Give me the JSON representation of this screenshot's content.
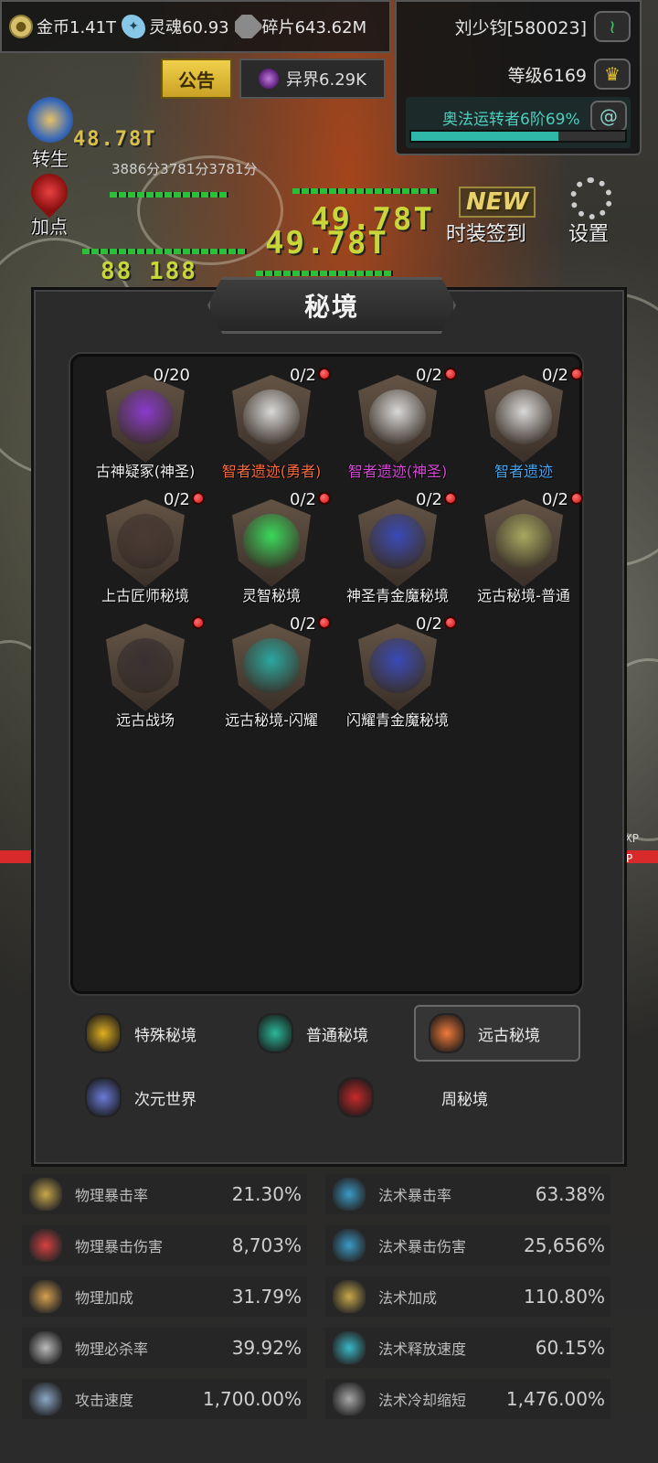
{
  "resources": {
    "gold": "金币1.41T",
    "soul": "灵魂60.93",
    "shard": "碎片643.62M"
  },
  "player": {
    "name": "刘少钧[580023]",
    "level": "等级6169",
    "arcane_title": "奥法运转者6阶69%",
    "arcane_progress": 0.69
  },
  "top_buttons": {
    "notice": "公告",
    "otherworld": "异界6.29K"
  },
  "side": {
    "rebirth": "转生",
    "addpoint": "加点",
    "score_text": "3886分3781分3781分"
  },
  "top_right": {
    "new_tag": "NEW",
    "costume_signin": "时装签到",
    "settings": "设置"
  },
  "modal": {
    "title": "秘境",
    "dungeons": [
      {
        "label": "古神疑冢(神圣)",
        "counter": "0/20",
        "red_dot": false,
        "label_color": "#f2f2f2",
        "art": "#8a3acb"
      },
      {
        "label": "智者遗迹(勇者)",
        "counter": "0/2",
        "red_dot": true,
        "label_color": "#ff6a3c",
        "art": "#d8d8d8"
      },
      {
        "label": "智者遗迹(神圣)",
        "counter": "0/2",
        "red_dot": true,
        "label_color": "#d84ad8",
        "art": "#d8d8d8"
      },
      {
        "label": "智者遗迹",
        "counter": "0/2",
        "red_dot": true,
        "label_color": "#48a8f0",
        "art": "#d8d8d8"
      },
      {
        "label": "上古匠师秘境",
        "counter": "0/2",
        "red_dot": true,
        "label_color": "#f2f2f2",
        "art": "#4a3a34"
      },
      {
        "label": "灵智秘境",
        "counter": "0/2",
        "red_dot": true,
        "label_color": "#f2f2f2",
        "art": "#3ad85a"
      },
      {
        "label": "神圣青金魔秘境",
        "counter": "0/2",
        "red_dot": true,
        "label_color": "#f2f2f2",
        "art": "#3a4ab8"
      },
      {
        "label": "远古秘境-普通",
        "counter": "0/2",
        "red_dot": true,
        "label_color": "#f2f2f2",
        "art": "#a8a860"
      },
      {
        "label": "远古战场",
        "counter": "",
        "red_dot": true,
        "label_color": "#f2f2f2",
        "art": "#3a3034"
      },
      {
        "label": "远古秘境-闪耀",
        "counter": "0/2",
        "red_dot": true,
        "label_color": "#f2f2f2",
        "art": "#2aa8a0"
      },
      {
        "label": "闪耀青金魔秘境",
        "counter": "0/2",
        "red_dot": true,
        "label_color": "#f2f2f2",
        "art": "#3a4ab8"
      }
    ],
    "tabs": [
      {
        "label": "特殊秘境",
        "active": false,
        "icon": "gold-crest-icon",
        "color": "#e0b020"
      },
      {
        "label": "普通秘境",
        "active": false,
        "icon": "jade-crest-icon",
        "color": "#2ab898"
      },
      {
        "label": "远古秘境",
        "active": true,
        "icon": "flame-crest-icon",
        "color": "#f07a3a"
      },
      {
        "label": "次元世界",
        "active": false,
        "icon": "w-star-icon",
        "color": "#6a7ad8"
      },
      {
        "label": "周秘境",
        "active": false,
        "icon": "red-gate-icon",
        "color": "#c82a2a"
      }
    ]
  },
  "stats": {
    "left": [
      {
        "label": "物理暴击率",
        "value": "21.30%",
        "color": "#c8a84a"
      },
      {
        "label": "物理暴击伤害",
        "value": "8,703%",
        "color": "#d84040"
      },
      {
        "label": "物理加成",
        "value": "31.79%",
        "color": "#d8a050"
      },
      {
        "label": "物理必杀率",
        "value": "39.92%",
        "color": "#bdbdbd"
      },
      {
        "label": "攻击速度",
        "value": "1,700.00%",
        "color": "#8aa8c8"
      }
    ],
    "right": [
      {
        "label": "法术暴击率",
        "value": "63.38%",
        "color": "#3a9ac8"
      },
      {
        "label": "法术暴击伤害",
        "value": "25,656%",
        "color": "#3a9ac8"
      },
      {
        "label": "法术加成",
        "value": "110.80%",
        "color": "#c8a84a"
      },
      {
        "label": "法术释放速度",
        "value": "60.15%",
        "color": "#38b8c8"
      },
      {
        "label": "法术冷却缩短",
        "value": "1,476.00%",
        "color": "#a8a8a8"
      }
    ]
  }
}
